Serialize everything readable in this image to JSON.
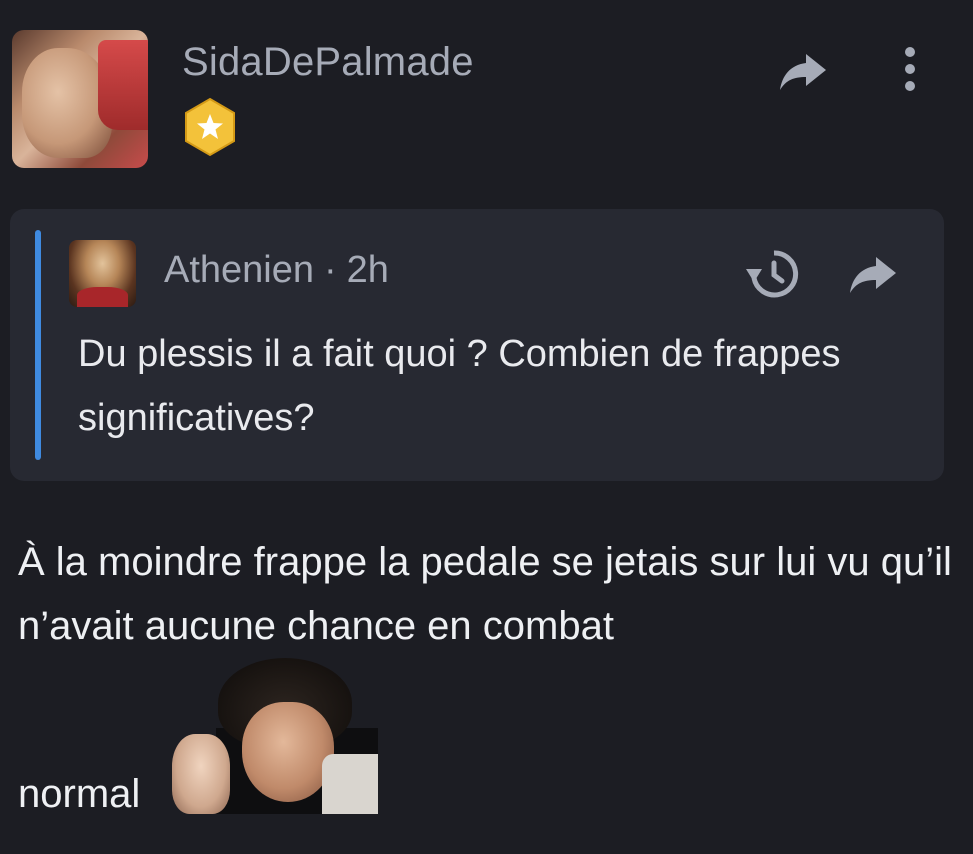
{
  "post": {
    "author": "SidaDePalmade",
    "badge": "star-badge",
    "colors": {
      "background": "#1c1d23",
      "quote_background": "#272932",
      "quote_accent": "#3f8ae0",
      "muted_text": "#a6abb7",
      "badge_gold": "#f3c23a"
    },
    "quote": {
      "author": "Athenien",
      "separator": "·",
      "time": "2h",
      "text": "Du plessis il a fait quoi ? Combien de frappes significatives?"
    },
    "body": "À la moindre frappe la pedale se jetais sur lui vu qu’il n’avait aucune chance en combat",
    "trailing_text": "normal",
    "icons": {
      "share": "share-arrow-icon",
      "more": "more-vertical-icon",
      "history": "history-icon"
    }
  }
}
